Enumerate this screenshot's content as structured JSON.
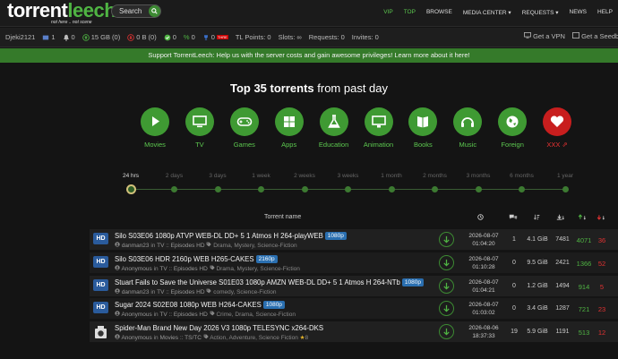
{
  "logo": {
    "main_a": "torrent",
    "main_b": "leech",
    "tagline": "not here .. not scene"
  },
  "search": {
    "label": "Search"
  },
  "nav": [
    {
      "label": "VIP",
      "state": "vip"
    },
    {
      "label": "TOP",
      "state": "active"
    },
    {
      "label": "BROWSE",
      "state": ""
    },
    {
      "label": "MEDIA CENTER ▾",
      "state": ""
    },
    {
      "label": "REQUESTS ▾",
      "state": ""
    },
    {
      "label": "NEWS",
      "state": ""
    },
    {
      "label": "HELP",
      "state": ""
    }
  ],
  "stats": {
    "username": "Djeki2121",
    "messages": "1",
    "notifications": "0",
    "upload": "15 GB (0)",
    "download": "0 B (0)",
    "ratio_a": "0",
    "ratio_b": "0",
    "bonus": "0",
    "tl_points": "TL Points: 0",
    "slots": "Slots: ∞",
    "requests": "Requests: 0",
    "invites": "Invites: 0",
    "get_vpn": "Get a VPN",
    "get_seedbox": "Get a Seedbo"
  },
  "banner": "Support TorrentLeech: Help us with the server costs and gain awesome privileges! Learn more about it here!",
  "title": {
    "bold": "Top 35 torrents",
    "rest": " from past day"
  },
  "categories": [
    {
      "label": "Movies"
    },
    {
      "label": "TV"
    },
    {
      "label": "Games"
    },
    {
      "label": "Apps"
    },
    {
      "label": "Education"
    },
    {
      "label": "Animation"
    },
    {
      "label": "Books"
    },
    {
      "label": "Music"
    },
    {
      "label": "Foreign"
    },
    {
      "label": "XXX ⇗"
    }
  ],
  "timeline": [
    "24 hrs",
    "2 days",
    "3 days",
    "1 week",
    "2 weeks",
    "3 weeks",
    "1 month",
    "2 months",
    "3 months",
    "6 months",
    "1 year"
  ],
  "table_header": {
    "name": "Torrent name"
  },
  "colors": {
    "accent": "#3f9a33",
    "leech": "#e23232",
    "res_badge": "#2a6fb0"
  },
  "torrents": [
    {
      "icon": "HD",
      "name": "Silo S03E06 1080p ATVP WEB-DL DD+ 5 1 Atmos H 264-playWEB",
      "res": "1080p",
      "uploader": "danman23",
      "cat": "TV :: Episodes HD",
      "tags": "Drama, Mystery, Science-Fiction",
      "rating": "",
      "date": "2026-08-07",
      "time": "01:04:20",
      "comments": "1",
      "size": "4.1 GiB",
      "snatched": "7481",
      "seeders": "4071",
      "leechers": "36"
    },
    {
      "icon": "HD",
      "name": "Silo S03E06 HDR 2160p WEB H265-CAKES",
      "res": "2160p",
      "uploader": "Anonymous",
      "cat": "TV :: Episodes HD",
      "tags": "Drama, Mystery, Science-Fiction",
      "rating": "",
      "date": "2026-08-07",
      "time": "01:10:28",
      "comments": "0",
      "size": "9.5 GiB",
      "snatched": "2421",
      "seeders": "1366",
      "leechers": "52"
    },
    {
      "icon": "HD",
      "name": "Stuart Fails to Save the Universe S01E03 1080p AMZN WEB-DL DD+ 5 1 Atmos H 264-NTb",
      "res": "1080p",
      "uploader": "danman23",
      "cat": "TV :: Episodes HD",
      "tags": "comedy, Science-Fiction",
      "rating": "",
      "date": "2026-08-07",
      "time": "01:04:21",
      "comments": "0",
      "size": "1.2 GiB",
      "snatched": "1494",
      "seeders": "914",
      "leechers": "5"
    },
    {
      "icon": "HD",
      "name": "Sugar 2024 S02E08 1080p WEB H264-CAKES",
      "res": "1080p",
      "uploader": "Anonymous",
      "cat": "TV :: Episodes HD",
      "tags": "Crime, Drama, Science-Fiction",
      "rating": "",
      "date": "2026-08-07",
      "time": "01:03:02",
      "comments": "0",
      "size": "3.4 GiB",
      "snatched": "1287",
      "seeders": "721",
      "leechers": "23"
    },
    {
      "icon": "TS",
      "name": "Spider-Man Brand New Day 2026 V3 1080p TELESYNC x264-DKS",
      "res": "",
      "uploader": "Anonymous",
      "cat": "Movies :: TS/TC",
      "tags": "Action, Adventure, Science Fiction",
      "rating": "8",
      "date": "2026-08-06",
      "time": "18:37:33",
      "comments": "19",
      "size": "5.9 GiB",
      "snatched": "1191",
      "seeders": "513",
      "leechers": "12"
    }
  ]
}
